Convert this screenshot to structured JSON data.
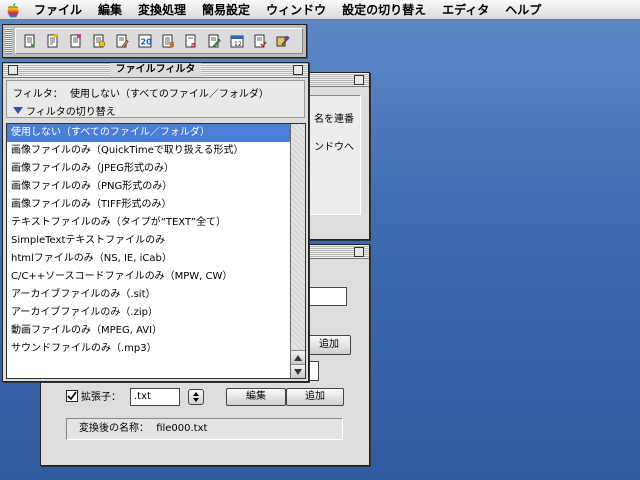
{
  "menubar": {
    "items": [
      "ファイル",
      "編集",
      "変換処理",
      "簡易設定",
      "ウィンドウ",
      "設定の切り替え",
      "エディタ",
      "ヘルプ"
    ]
  },
  "toolbar": {
    "buttons": [
      "toolbar-icon-1",
      "toolbar-icon-2",
      "toolbar-icon-3",
      "toolbar-icon-4",
      "toolbar-icon-5",
      "toolbar-icon-6",
      "toolbar-icon-7",
      "toolbar-icon-8",
      "toolbar-icon-9",
      "toolbar-icon-10",
      "toolbar-icon-11",
      "toolbar-icon-12"
    ]
  },
  "background_window_1": {
    "text_fragment_1": "名を連番",
    "text_fragment_2": "ンドウへ"
  },
  "background_window_2": {
    "button_label": "追加",
    "extension_label": "拡張子：",
    "extension_value": ".txt",
    "edit_button": "編集",
    "add_button": "追加",
    "result_label": "変換後の名称：",
    "result_value": "file000.txt"
  },
  "filter_window": {
    "title": "ファイルフィルタ",
    "filter_label": "フィルタ：",
    "filter_value": "使用しない（すべてのファイル／フォルダ）",
    "toggle_label": "フィルタの切り替え",
    "items": [
      "使用しない（すべてのファイル／フォルダ）",
      "画像ファイルのみ（QuickTimeで取り扱える形式）",
      "画像ファイルのみ（JPEG形式のみ）",
      "画像ファイルのみ（PNG形式のみ）",
      "画像ファイルのみ（TIFF形式のみ）",
      "テキストファイルのみ（タイプが“TEXT”全て）",
      "SimpleTextテキストファイルのみ",
      "htmlファイルのみ（NS, IE, iCab）",
      "C/C++ソースコードファイルのみ（MPW, CW）",
      "アーカイブファイルのみ（.sit）",
      "アーカイブファイルのみ（.zip）",
      "動画ファイルのみ（MPEG, AVI）",
      "サウンドファイルのみ（.mp3）"
    ],
    "selected_index": 0
  },
  "colors": {
    "desktop": "#3f6fb0",
    "selection": "#4b7ed6"
  }
}
